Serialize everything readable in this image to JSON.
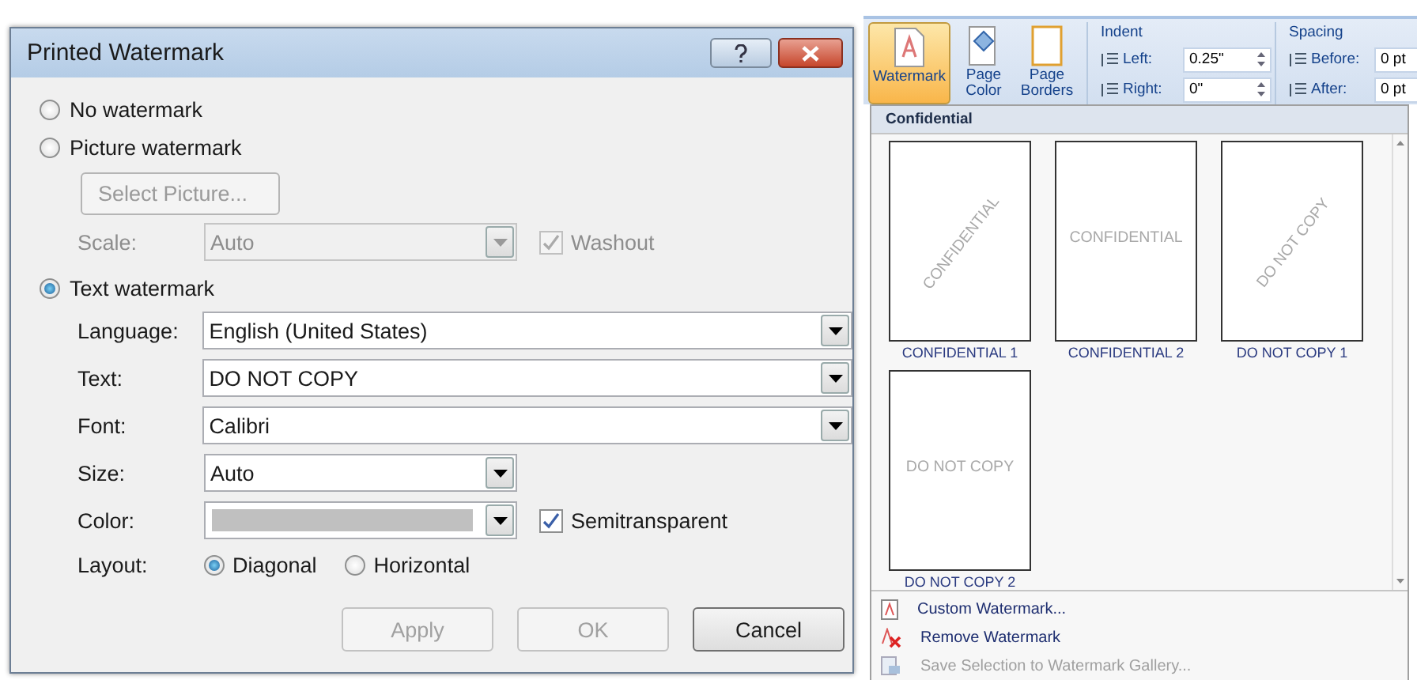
{
  "dialog": {
    "title": "Printed Watermark",
    "modes": [
      {
        "label": "No watermark",
        "selected": false
      },
      {
        "label": "Picture watermark",
        "selected": false
      },
      {
        "label": "Text watermark",
        "selected": true
      }
    ],
    "picture": {
      "select_button": {
        "label": "Select Picture...",
        "disabled": true
      },
      "scale": {
        "label": "Scale:",
        "value": "Auto",
        "disabled": true
      },
      "washout": {
        "label": "Washout",
        "checked": true,
        "disabled": true
      }
    },
    "fields": [
      {
        "kind": "wide",
        "label": "Language:",
        "value": "English (United States)"
      },
      {
        "kind": "wide",
        "label": "Text:",
        "value": "DO NOT COPY"
      },
      {
        "kind": "wide",
        "label": "Font:",
        "value": "Calibri"
      },
      {
        "kind": "short",
        "label": "Size:",
        "value": "Auto"
      },
      {
        "kind": "color",
        "label": "Color:",
        "color": "#c0c0c0"
      }
    ],
    "semitransparent": {
      "label": "Semitransparent",
      "checked": true
    },
    "layout": {
      "label": "Layout:",
      "options": [
        {
          "label": "Diagonal",
          "selected": true
        },
        {
          "label": "Horizontal",
          "selected": false
        }
      ]
    },
    "buttons": [
      {
        "label": "Apply",
        "disabled": true
      },
      {
        "label": "OK",
        "disabled": true
      },
      {
        "label": "Cancel",
        "disabled": false
      }
    ]
  },
  "ribbon": {
    "buttons": [
      {
        "kind": "watermark",
        "label": "Watermark",
        "selected": true
      },
      {
        "kind": "color",
        "label": "Page Color",
        "selected": false
      },
      {
        "kind": "borders",
        "label": "Page Borders",
        "selected": false
      }
    ],
    "indent": {
      "title": "Indent",
      "rows": [
        {
          "label": "Left:",
          "value": "0.25\""
        },
        {
          "label": "Right:",
          "value": "0\""
        }
      ]
    },
    "spacing": {
      "title": "Spacing",
      "rows": [
        {
          "label": "Before:",
          "value": "0 pt"
        },
        {
          "label": "After:",
          "value": "0 pt"
        }
      ]
    }
  },
  "gallery": {
    "heading": "Confidential",
    "items": [
      {
        "caption": "CONFIDENTIAL 1",
        "text": "CONFIDENTIAL",
        "diagonal": true
      },
      {
        "caption": "CONFIDENTIAL 2",
        "text": "CONFIDENTIAL",
        "diagonal": false
      },
      {
        "caption": "DO NOT COPY 1",
        "text": "DO NOT COPY",
        "diagonal": true
      },
      {
        "caption": "DO NOT COPY 2",
        "text": "DO NOT COPY",
        "diagonal": false
      }
    ],
    "menu": [
      {
        "kind": "custom",
        "label": "Custom Watermark...",
        "disabled": false
      },
      {
        "kind": "remove",
        "label": "Remove Watermark",
        "disabled": false
      },
      {
        "kind": "save",
        "label": "Save Selection to Watermark Gallery...",
        "disabled": true
      }
    ]
  }
}
